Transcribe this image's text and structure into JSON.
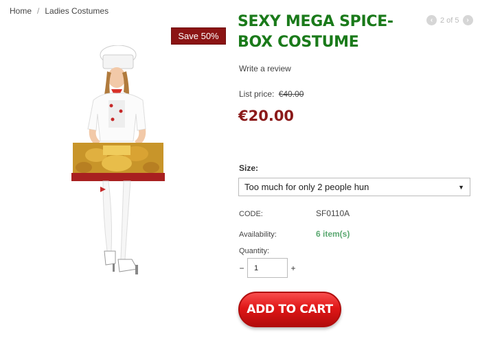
{
  "breadcrumb": {
    "home": "Home",
    "separator": "/",
    "category": "Ladies Costumes"
  },
  "badge": {
    "text": "Save 50%"
  },
  "product": {
    "title": "SEXY MEGA SPICE-BOX COSTUME",
    "review_link": "Write a review",
    "list_price_label": "List price:",
    "list_price": "€40.00",
    "price": "€20.00"
  },
  "pager": {
    "text": "2 of 5",
    "prev_icon": "chevron-left-icon",
    "next_icon": "chevron-right-icon"
  },
  "options": {
    "size_label": "Size:",
    "size_selected": "Too much for only 2 people hun"
  },
  "details": {
    "code_label": "CODE:",
    "code_value": "SF0110A",
    "availability_label": "Availability:",
    "availability_value": "6  item(s)",
    "quantity_label": "Quantity:",
    "quantity_value": "1",
    "minus": "−",
    "plus": "+"
  },
  "cart": {
    "label": "ADD TO CART"
  },
  "colors": {
    "title": "#1a7a1a",
    "price": "#8b1a1a",
    "badge": "#8b1414",
    "availability": "#5aa870",
    "cart_button": "#e01717"
  }
}
